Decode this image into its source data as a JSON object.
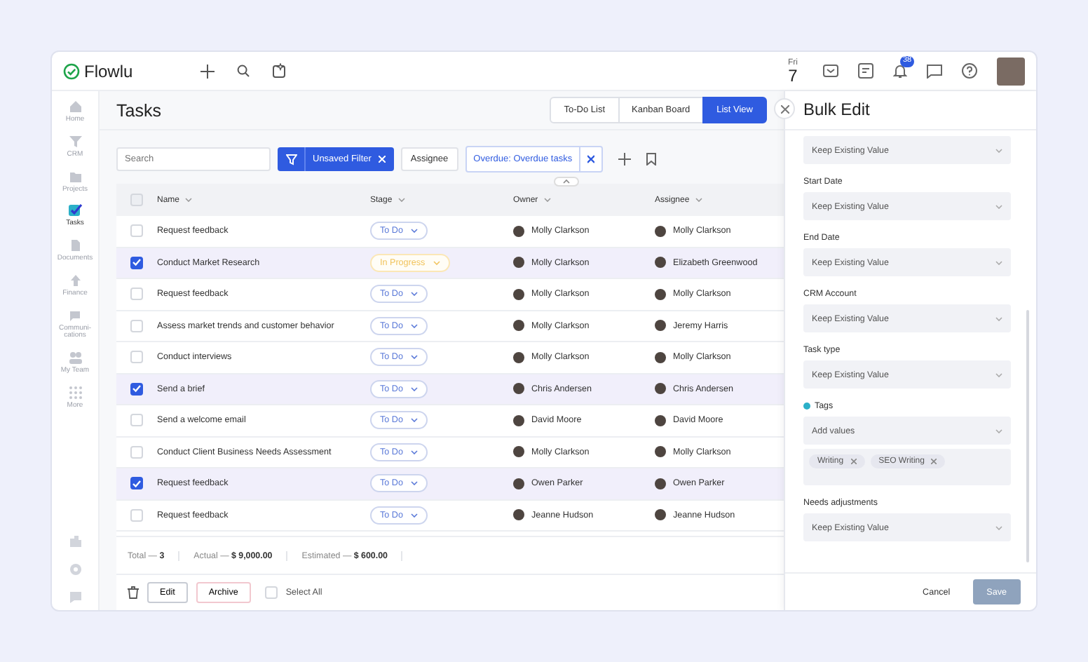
{
  "app": {
    "logo": "Flowlu"
  },
  "date": {
    "weekday": "Fri",
    "day": "7"
  },
  "notifications": {
    "badge": "38"
  },
  "sidebar": {
    "items": [
      {
        "label": "Home",
        "selected": false
      },
      {
        "label": "CRM",
        "selected": false
      },
      {
        "label": "Projects",
        "selected": false
      },
      {
        "label": "Tasks",
        "selected": true
      },
      {
        "label": "Documents",
        "selected": false
      },
      {
        "label": "Finance",
        "selected": false
      },
      {
        "label": "Communi-cations",
        "selected": false
      },
      {
        "label": "My Team",
        "selected": false
      },
      {
        "label": "More",
        "selected": false
      }
    ]
  },
  "page": {
    "title": "Tasks"
  },
  "views": [
    {
      "label": "To-Do List",
      "selected": false
    },
    {
      "label": "Kanban Board",
      "selected": false
    },
    {
      "label": "List View",
      "selected": true
    }
  ],
  "toolbar": {
    "search": {
      "placeholder": "Search"
    },
    "filter": "Unsaved Filter",
    "assignee": "Assignee",
    "chip": "Overdue: Overdue tasks"
  },
  "table": {
    "header_checked": false,
    "columns": [
      "Name",
      "Stage",
      "Owner",
      "Assignee"
    ],
    "rows": [
      {
        "selected": false,
        "name": "Request feedback",
        "stage": {
          "label": "To Do",
          "kind": "todo"
        },
        "owner": "Molly Clarkson",
        "assignee": "Molly Clarkson"
      },
      {
        "selected": true,
        "name": "Conduct Market Research",
        "stage": {
          "label": "In Progress",
          "kind": "in_progress"
        },
        "owner": "Molly Clarkson",
        "assignee": "Elizabeth Greenwood"
      },
      {
        "selected": false,
        "name": "Request feedback",
        "stage": {
          "label": "To Do",
          "kind": "todo"
        },
        "owner": "Molly Clarkson",
        "assignee": "Molly Clarkson"
      },
      {
        "selected": false,
        "name": "Assess market trends and customer behavior",
        "stage": {
          "label": "To Do",
          "kind": "todo"
        },
        "owner": "Molly Clarkson",
        "assignee": "Jeremy Harris"
      },
      {
        "selected": false,
        "name": "Conduct interviews",
        "stage": {
          "label": "To Do",
          "kind": "todo"
        },
        "owner": "Molly Clarkson",
        "assignee": "Molly Clarkson"
      },
      {
        "selected": true,
        "name": "Send a brief",
        "stage": {
          "label": "To Do",
          "kind": "todo"
        },
        "owner": "Chris Andersen",
        "assignee": "Chris Andersen"
      },
      {
        "selected": false,
        "name": "Send a welcome email",
        "stage": {
          "label": "To Do",
          "kind": "todo"
        },
        "owner": "David Moore",
        "assignee": "David Moore"
      },
      {
        "selected": false,
        "name": "Conduct Client Business Needs Assessment",
        "stage": {
          "label": "To Do",
          "kind": "todo"
        },
        "owner": "Molly Clarkson",
        "assignee": "Molly Clarkson"
      },
      {
        "selected": true,
        "name": "Request feedback",
        "stage": {
          "label": "To Do",
          "kind": "todo"
        },
        "owner": "Owen Parker",
        "assignee": "Owen Parker"
      },
      {
        "selected": false,
        "name": "Request feedback",
        "stage": {
          "label": "To Do",
          "kind": "todo"
        },
        "owner": "Jeanne Hudson",
        "assignee": "Jeanne Hudson"
      }
    ]
  },
  "totals": [
    "Total — **3**",
    "Actual — **$ 9,000.00**",
    "Estimated — **$ 600.00**"
  ],
  "actions": {
    "edit": "Edit",
    "archive": "Archive",
    "select_all": {
      "label": "Select All",
      "checked": false
    }
  },
  "panel": {
    "title": "Bulk Edit",
    "fields": [
      {
        "kind": "select",
        "value": "Keep Existing Value"
      },
      {
        "kind": "select",
        "label": "Start Date",
        "value": "Keep Existing Value"
      },
      {
        "kind": "select",
        "label": "End Date",
        "value": "Keep Existing Value"
      },
      {
        "kind": "select",
        "label": "CRM Account",
        "value": "Keep Existing Value"
      },
      {
        "kind": "select",
        "label": "Task type",
        "value": "Keep Existing Value"
      },
      {
        "kind": "tags",
        "label": "Tags",
        "placeholder": "Add values",
        "tags": [
          "Writing",
          "SEO Writing"
        ]
      },
      {
        "kind": "select",
        "label": "Needs adjustments",
        "value": "Keep Existing Value"
      }
    ],
    "cancel": "Cancel",
    "save": {
      "label": "Save",
      "disabled": true
    }
  }
}
